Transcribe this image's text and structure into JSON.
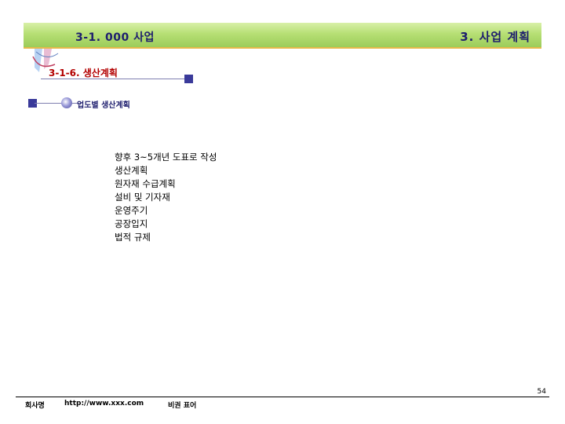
{
  "header": {
    "left_title": "3-1. 000 사업",
    "right_title": "3. 사업 계획"
  },
  "subheader": {
    "title": "3-1-6. 생산계획"
  },
  "section": {
    "title": "업도별 생산계획"
  },
  "items": [
    "향후 3~5개년 도표로 작성",
    "생산계획",
    "원자재 수급계획",
    "설비 및 기자재",
    "운영주기",
    "공장입지",
    "법적 규제"
  ],
  "footer": {
    "company": "회사명",
    "url": "http://www.xxx.com",
    "secret": "비권 표어",
    "page_number": "54"
  },
  "colors": {
    "header_bg": "#b6df74",
    "header_text": "#1e1e6e",
    "subtitle_text": "#b30000",
    "square_accent": "#3a3a9a"
  }
}
